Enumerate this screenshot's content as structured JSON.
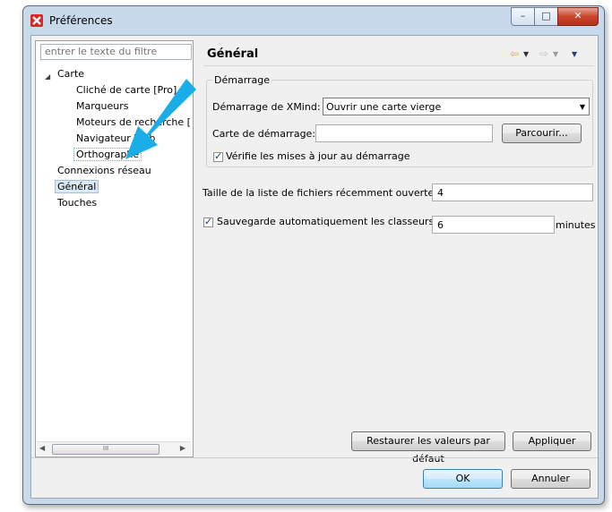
{
  "window": {
    "title": "Préférences",
    "controls": {
      "minimize": "–",
      "maximize": "□",
      "close": "✕"
    }
  },
  "sidebar": {
    "filter_placeholder": "entrer le texte du filtre",
    "toggle_glyph": "◢",
    "items": [
      {
        "label": "Carte"
      },
      {
        "label": "Cliché de carte [Pro]"
      },
      {
        "label": "Marqueurs"
      },
      {
        "label": "Moteurs de recherche ["
      },
      {
        "label": "Navigateur Web"
      },
      {
        "label": "Orthographe"
      },
      {
        "label": "Connexions réseau"
      },
      {
        "label": "Général"
      },
      {
        "label": "Touches"
      }
    ],
    "scroll_thumb": "III"
  },
  "page": {
    "title": "Général",
    "nav": {
      "back": "⇦",
      "forward": "⇨",
      "dropdown": "▼"
    },
    "startup_group": {
      "title": "Démarrage",
      "xmind_label": "Démarrage de XMind:",
      "xmind_value": "Ouvrir une carte vierge",
      "map_label": "Carte de démarrage:",
      "map_value": "",
      "browse_label": "Parcourir...",
      "check_updates_label": "Vérifie les mises à jour au démarrage",
      "check_updates_checked": "✓"
    },
    "recent_label": "Taille de la liste de fichiers récemment ouverte:",
    "recent_value": "4",
    "autosave_label": "Sauvegarde automatiquement les classeurs",
    "autosave_checked": "✓",
    "autosave_value": "6",
    "autosave_unit": "minutes",
    "restore_defaults_label": "Restaurer les valeurs par défaut",
    "apply_label": "Appliquer"
  },
  "footer": {
    "ok_label": "OK",
    "cancel_label": "Annuler"
  },
  "colors": {
    "arrow": "#1aaee8",
    "selection": "#dce9f8",
    "app_icon": "#d8262b"
  },
  "icons": {
    "app": "xmind-icon",
    "arrow": "annotation-arrow-icon"
  }
}
